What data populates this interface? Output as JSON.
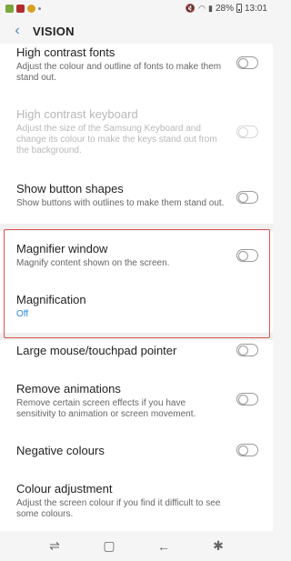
{
  "status_bar": {
    "time": "13:01",
    "battery": "28%",
    "icons_left": [
      "app-icon",
      "youtube-icon",
      "notification-icon",
      "more-icon"
    ],
    "icons_right": [
      "mute-icon",
      "wifi-icon",
      "signal-icon",
      "battery-icon"
    ]
  },
  "header": {
    "title": "VISION"
  },
  "settings": [
    {
      "title": "High contrast fonts",
      "subtitle": "Adjust the colour and outline of fonts to make them stand out.",
      "toggle": false,
      "enabled": true
    },
    {
      "title": "High contrast keyboard",
      "subtitle": "Adjust the size of the Samsung Keyboard and change its colour to make the keys stand out from the background.",
      "toggle": false,
      "enabled": false
    },
    {
      "title": "Show button shapes",
      "subtitle": "Show buttons with outlines to make them stand out.",
      "toggle": false,
      "enabled": true
    },
    {
      "title": "Magnifier window",
      "subtitle": "Magnify content shown on the screen.",
      "toggle": false,
      "enabled": true
    },
    {
      "title": "Magnification",
      "subtitle": "Off",
      "enabled": true
    },
    {
      "title": "Large mouse/touchpad pointer",
      "toggle": false,
      "enabled": true
    },
    {
      "title": "Remove animations",
      "subtitle": "Remove certain screen effects if you have sensitivity to animation or screen movement.",
      "toggle": false,
      "enabled": true
    },
    {
      "title": "Negative colours",
      "toggle": false,
      "enabled": true
    },
    {
      "title": "Colour adjustment",
      "subtitle": "Adjust the screen colour if you find it difficult to see some colours.",
      "enabled": true
    }
  ],
  "colors": {
    "accent": "#2e8bd6",
    "highlight_border": "#d9534f"
  },
  "nav_bar": [
    "recents-icon",
    "home-icon",
    "back-icon",
    "accessibility-icon"
  ]
}
